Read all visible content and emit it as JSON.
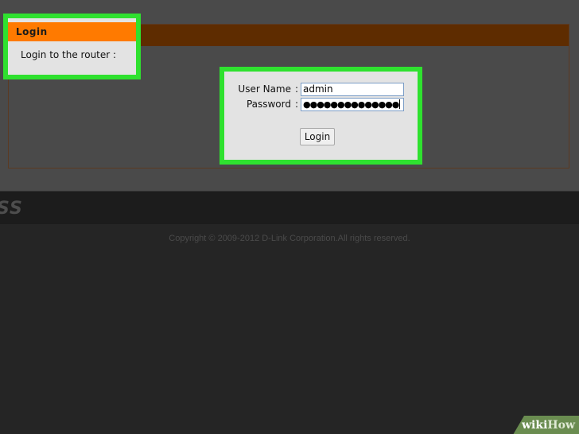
{
  "login_header": {
    "title": "Login",
    "subtitle": "Login to the router :"
  },
  "form": {
    "username_label": "User Name",
    "password_label": "Password",
    "separator": ":",
    "username_value": "admin",
    "password_masked": "●●●●●●●●●●●●●●",
    "login_button": "Login"
  },
  "brand": {
    "partial_text": "SS"
  },
  "footer": {
    "copyright": "Copyright © 2009-2012 D-Link Corporation.All rights reserved."
  },
  "watermark": {
    "part1": "wiki",
    "part2": "How"
  },
  "colors": {
    "highlight": "#2fe12f",
    "header_orange": "#ff7a00"
  }
}
